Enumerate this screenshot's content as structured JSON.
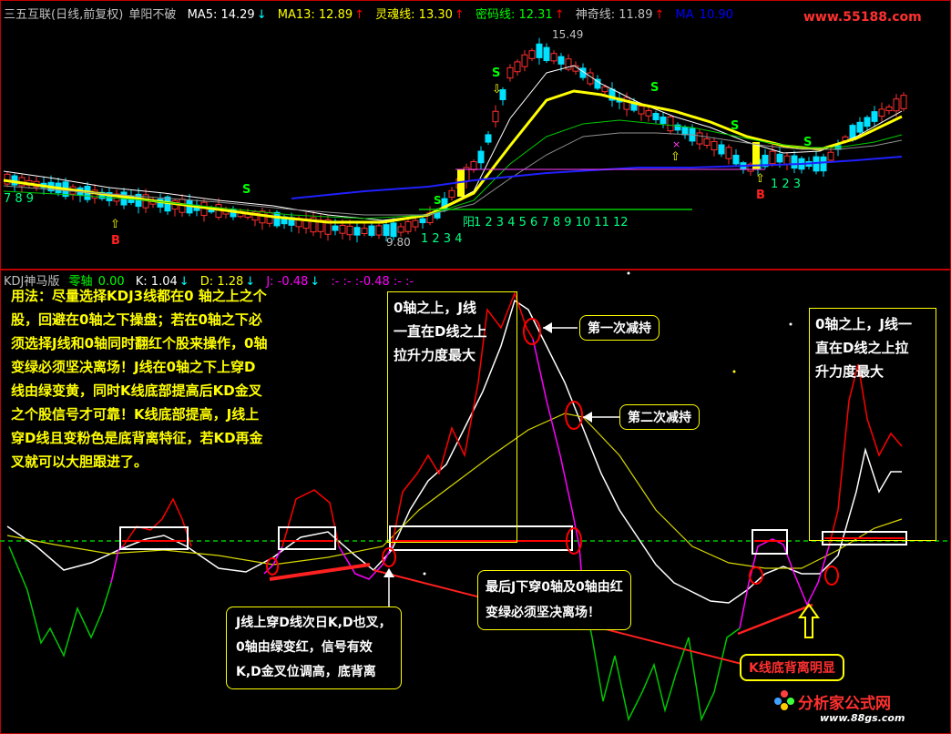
{
  "main_header": {
    "stock": "三五互联(日线,前复权)",
    "formula": "单阳不破",
    "ma5": "MA5: 14.29",
    "ma13": "MA13: 12.89",
    "soul": "灵魂线: 13.30",
    "secret": "密码线: 12.31",
    "magic": "神奇线: 11.89",
    "ma_last": "MA",
    "ma_last_val": "10.90"
  },
  "watermark_top": "www.55188.com",
  "price_labels": {
    "high": "15.49",
    "low": "9.80",
    "yang": "阳",
    "count_left": "7 8 9",
    "count_mid": "1 2 3 4",
    "count_after": "1 2 3 4 5 6 7 8 9 10 11 12",
    "count_right": "1 2 3"
  },
  "kdj_header": {
    "name": "KDJ神马版",
    "zero_label": "零轴",
    "zero_val": "0.00",
    "k": "K: 1.04",
    "d": "D: 1.28",
    "j": "J: -0.48",
    "tail": ":- :- :-0.48 :- :-"
  },
  "notes": {
    "usage": [
      "用法：尽量选择KDJ3线都在0 轴之上之个",
      "股，回避在0轴之下操盘；若在0轴之下必",
      "须选择J线和0轴同时翻红个股来操作，0轴",
      "变绿必须坚决离场！J线在0轴之下上穿D",
      "线由绿变黄，同时K线底部提高后KD金叉",
      "之个股信号才可靠！K线底部提高，J线上",
      "穿D线且变粉色是底背离特征，若KD再金",
      "叉就可以大胆跟进了。"
    ],
    "box_mid": [
      "0轴之上，J线",
      "一直在D线之上",
      "拉升力度最大"
    ],
    "box_right": [
      "0轴之上，J线一",
      "直在D线之上拉",
      "升力度最大"
    ],
    "reduce1": "第一次减持",
    "reduce2": "第二次减持",
    "bottom_left": [
      "J线上穿D线次日K,D也叉，",
      "0轴由绿变红，信号有效",
      "K,D金叉位调高，底背离"
    ],
    "bottom_mid": [
      "最后J下穿0轴及0轴由红",
      "变绿必须坚决离场！"
    ],
    "divergence": "K线底背离明显"
  },
  "logo": {
    "text": "分析家公式网",
    "url": "www.88gs.com"
  },
  "colors": {
    "yellow": "#ffff00",
    "red": "#ff0000",
    "white": "#ffffff",
    "green": "#00c800",
    "magenta": "#ff00ff",
    "blue": "#0000ff",
    "cyan": "#00ffff"
  }
}
